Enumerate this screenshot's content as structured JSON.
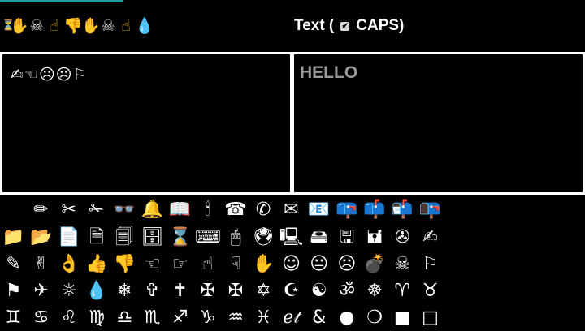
{
  "header": {
    "emoji_strip": [
      "⏳",
      "✋",
      "☠",
      "☝",
      "👎",
      "✋",
      "☠",
      "☝",
      "💧"
    ],
    "caps_label_prefix": "Text (",
    "caps_label_suffix": "CAPS)",
    "caps_checked": true,
    "checkbox_glyph": "✔"
  },
  "editor": {
    "wingdings_text": "✍☜☹☹⚐",
    "plain_text": "HELLO"
  },
  "glyph_rows": [
    [
      "✏",
      "✂",
      "✁",
      "👓",
      "🔔",
      "📖",
      "🕯",
      "☎",
      "✆",
      "✉",
      "📧",
      "📪",
      "📫",
      "📬",
      "📭"
    ],
    [
      "📁",
      "📂",
      "📄",
      "🗎",
      "🗐",
      "🗄",
      "⌛",
      "⌨",
      "🖱",
      "🖲",
      "🖳",
      "🖴",
      "🖫",
      "🖬",
      "✇",
      "✍"
    ],
    [
      "✎",
      "✌",
      "👌",
      "👍",
      "👎",
      "☜",
      "☞",
      "☝",
      "☟",
      "✋",
      "☺",
      "😐",
      "☹",
      "💣",
      "☠",
      "⚐"
    ],
    [
      "⚑",
      "✈",
      "☼",
      "💧",
      "❄",
      "✞",
      "✝",
      "✠",
      "✠",
      "✡",
      "☪",
      "☯",
      "ॐ",
      "☸",
      "♈",
      "♉"
    ],
    [
      "♊",
      "♋",
      "♌",
      "♍",
      "♎",
      "♏",
      "♐",
      "♑",
      "♒",
      "♓",
      "ℯ𝓉",
      "&",
      "●",
      "❍",
      "■",
      "□"
    ]
  ],
  "colors": {
    "accent": "#1fa29a",
    "pane_border": "#ffffff",
    "preview_text": "#9a9a9a"
  }
}
